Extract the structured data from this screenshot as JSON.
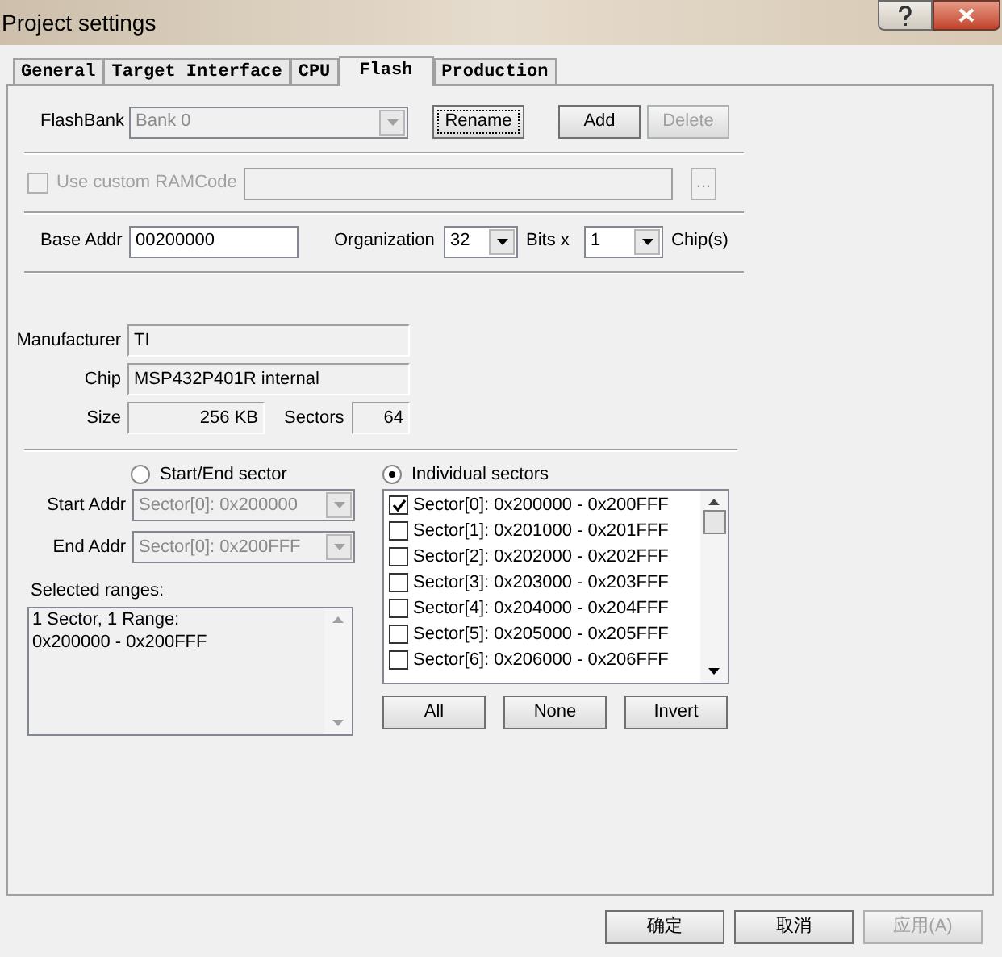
{
  "window": {
    "title": "Project settings"
  },
  "tabs": [
    {
      "label": "General",
      "selected": false
    },
    {
      "label": "Target Interface",
      "selected": false
    },
    {
      "label": "CPU",
      "selected": false
    },
    {
      "label": "Flash",
      "selected": true
    },
    {
      "label": "Production",
      "selected": false
    }
  ],
  "flash_bank": {
    "label": "FlashBank",
    "value": "Bank 0",
    "disabled": true
  },
  "bank_buttons": [
    {
      "label": "Rename",
      "disabled": false,
      "focused": true
    },
    {
      "label": "Add",
      "disabled": false,
      "focused": false
    },
    {
      "label": "Delete",
      "disabled": true,
      "focused": false
    }
  ],
  "ramcode": {
    "label": "Use custom RAMCode",
    "checked": false,
    "disabled": true,
    "browse_label": "..."
  },
  "base_addr": {
    "label": "Base Addr",
    "value": "00200000"
  },
  "organization": {
    "label": "Organization",
    "value": "32",
    "unit": "Bits x"
  },
  "chips": {
    "value": "1",
    "label": "Chip(s)"
  },
  "info": {
    "manufacturer_label": "Manufacturer",
    "manufacturer": "TI",
    "chip_label": "Chip",
    "chip": "MSP432P401R internal",
    "size_label": "Size",
    "size": "256 KB",
    "sectors_label": "Sectors",
    "sectors": "64"
  },
  "range_modes": [
    {
      "label": "Start/End sector",
      "selected": false
    },
    {
      "label": "Individual sectors",
      "selected": true
    }
  ],
  "start_addr": {
    "label": "Start Addr",
    "value": "Sector[0]: 0x200000",
    "disabled": true
  },
  "end_addr": {
    "label": "End Addr",
    "value": "Sector[0]: 0x200FFF",
    "disabled": true
  },
  "selected_ranges": {
    "label": "Selected ranges:",
    "lines": [
      "1 Sector, 1 Range:",
      "0x200000 - 0x200FFF"
    ]
  },
  "sector_list": [
    {
      "label": "Sector[0]: 0x200000 - 0x200FFF",
      "checked": true
    },
    {
      "label": "Sector[1]: 0x201000 - 0x201FFF",
      "checked": false
    },
    {
      "label": "Sector[2]: 0x202000 - 0x202FFF",
      "checked": false
    },
    {
      "label": "Sector[3]: 0x203000 - 0x203FFF",
      "checked": false
    },
    {
      "label": "Sector[4]: 0x204000 - 0x204FFF",
      "checked": false
    },
    {
      "label": "Sector[5]: 0x205000 - 0x205FFF",
      "checked": false
    },
    {
      "label": "Sector[6]: 0x206000 - 0x206FFF",
      "checked": false
    }
  ],
  "sector_buttons": [
    "All",
    "None",
    "Invert"
  ],
  "dialog_buttons": [
    {
      "label": "确定",
      "disabled": false
    },
    {
      "label": "取消",
      "disabled": false
    },
    {
      "label": "应用(A)",
      "disabled": true
    }
  ]
}
